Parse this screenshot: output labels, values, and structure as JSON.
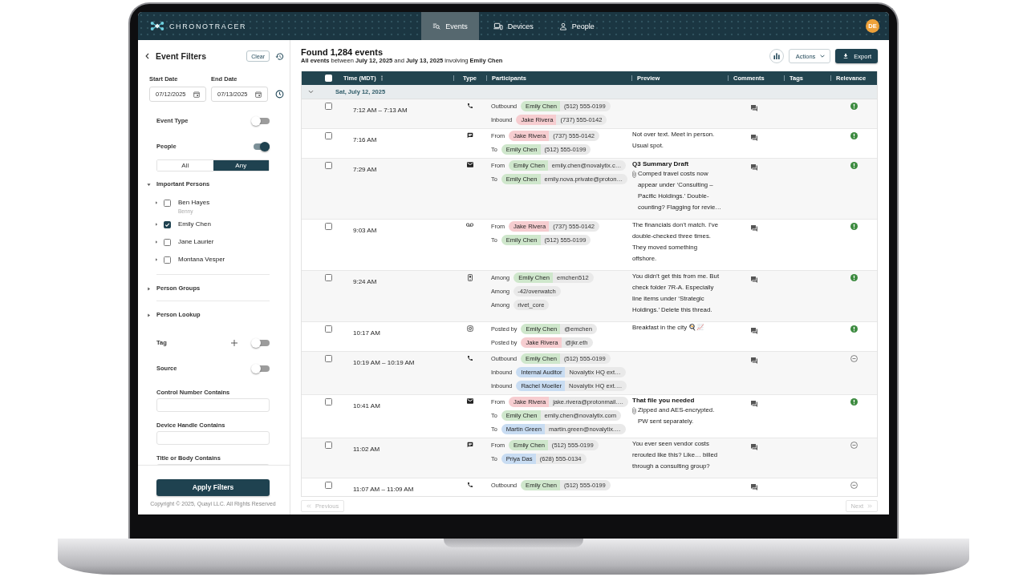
{
  "app": {
    "brand": "CHRONOTRACER",
    "nav": [
      {
        "label": "Events",
        "selected": true
      },
      {
        "label": "Devices",
        "selected": false
      },
      {
        "label": "People",
        "selected": false
      }
    ],
    "avatar": "DE"
  },
  "filters": {
    "title": "Event Filters",
    "clear_button": "Clear",
    "dates": [
      {
        "label": "Start Date",
        "value": "07/12/2025"
      },
      {
        "label": "End Date",
        "value": "07/13/2025"
      }
    ],
    "sections": [
      {
        "kind": "toggle",
        "label": "Event Type",
        "on": false
      },
      {
        "kind": "toggle",
        "label": "People",
        "on": true,
        "modes": [
          {
            "label": "All",
            "selected": false
          },
          {
            "label": "Any",
            "selected": true
          }
        ]
      },
      {
        "kind": "tree",
        "label": "Important Persons",
        "expanded": true,
        "children": [
          {
            "label": "Ben Hayes",
            "alias": "Benny",
            "checked": false,
            "expanded": false
          },
          {
            "label": "Emily Chen",
            "checked": true,
            "expanded": false
          },
          {
            "label": "Jane Laurier",
            "checked": false,
            "expanded": false
          },
          {
            "label": "Montana Vesper",
            "checked": false,
            "expanded": false
          }
        ]
      },
      {
        "kind": "tree",
        "label": "Person Groups",
        "expanded": false
      },
      {
        "kind": "tree",
        "label": "Person Lookup",
        "expanded": false
      },
      {
        "kind": "toggle",
        "label": "Tag",
        "on": false,
        "addable": true
      },
      {
        "kind": "toggle",
        "label": "Source",
        "on": false
      },
      {
        "kind": "text",
        "label": "Control Number Contains"
      },
      {
        "kind": "text",
        "label": "Device Handle Contains"
      },
      {
        "kind": "text",
        "label": "Title or Body Contains"
      }
    ],
    "apply_button": "Apply Filters",
    "copyright": "Copyright © 2025, Quayi LLC. All Rights Reserved"
  },
  "results": {
    "title": "Found 1,284 events",
    "summary": "**All events** between **July 12, 2025** and **July 13, 2025** involving **Emily Chen**",
    "actions_button": "Actions",
    "export_button": "Export"
  },
  "table": {
    "select_all_checked": false,
    "columns": [
      {
        "label": "Time (MDT)",
        "menu": true
      },
      {
        "label": "Type"
      },
      {
        "label": "Participants"
      },
      {
        "label": "Preview"
      },
      {
        "label": "Comments"
      },
      {
        "label": "Tags"
      },
      {
        "label": "Relevance"
      }
    ],
    "groups": [
      {
        "label": "Sat, July 12, 2025",
        "expanded": true,
        "rows": [
          {
            "time": "7:12 AM – 7:13 AM",
            "kind": "call",
            "checked": false,
            "participants": [
              {
                "role": "Outbound",
                "name": "Emily Chen",
                "color": "#cfe7cc",
                "handle": "(512) 555-0199"
              },
              {
                "role": "Inbound",
                "name": "Jake Rivera",
                "color": "#f6cdd0",
                "handle": "(737) 555-0142"
              }
            ],
            "relevant": true
          },
          {
            "time": "7:16 AM",
            "kind": "text",
            "checked": false,
            "participants": [
              {
                "role": "From",
                "name": "Jake Rivera",
                "color": "#f6cdd0",
                "handle": "(737) 555-0142"
              },
              {
                "role": "To",
                "name": "Emily Chen",
                "color": "#cfe7cc",
                "handle": "(512) 555-0199"
              }
            ],
            "preview": {
              "text": "Not over text. Meet in person. Usual spot."
            },
            "relevant": true
          },
          {
            "time": "7:29 AM",
            "kind": "email",
            "checked": false,
            "participants": [
              {
                "role": "From",
                "name": "Emily Chen",
                "color": "#cfe7cc",
                "handle": "emily.chen@novalytix.c…"
              },
              {
                "role": "To",
                "name": "Emily Chen",
                "color": "#cfe7cc",
                "handle": "emily.nova.private@proton…"
              }
            ],
            "preview": {
              "title": "Q3 Summary Draft",
              "attachment": true,
              "text": "Comped travel costs now appear under ‘Consulting – Pacific Holdings.’ Double-counting? Flagging for revie…"
            },
            "relevant": true
          },
          {
            "time": "9:03 AM",
            "kind": "voicemail",
            "checked": false,
            "participants": [
              {
                "role": "From",
                "name": "Jake Rivera",
                "color": "#f6cdd0",
                "handle": "(737) 555-0142"
              },
              {
                "role": "To",
                "name": "Emily Chen",
                "color": "#cfe7cc",
                "handle": "(512) 555-0199"
              }
            ],
            "preview": {
              "text": "The financials don’t match. I’ve double-checked three times. They moved something offshore."
            },
            "relevant": true
          },
          {
            "time": "9:24 AM",
            "kind": "chat",
            "checked": false,
            "participants": [
              {
                "role": "Among",
                "name": "Emily Chen",
                "color": "#cfe7cc",
                "handle": "emchen512"
              },
              {
                "role": "Among",
                "handle": "-42/overwatch"
              },
              {
                "role": "Among",
                "handle": "rivet_core"
              }
            ],
            "preview": {
              "text": "You didn’t get this from me. But check folder 7R-A. Especially line items under ‘Strategic Holdings.’ Delete this thread."
            },
            "relevant": true
          },
          {
            "time": "10:17 AM",
            "kind": "post",
            "checked": false,
            "participants": [
              {
                "role": "Posted by",
                "name": "Emily Chen",
                "color": "#cfe7cc",
                "handle": "@emchen"
              },
              {
                "role": "Posted by",
                "name": "Jake Rivera",
                "color": "#f6cdd0",
                "handle": "@jkr.eth"
              }
            ],
            "preview": {
              "text": "Breakfast in the city 🍳📈"
            },
            "relevant": true
          },
          {
            "time": "10:19 AM – 10:19 AM",
            "kind": "call",
            "checked": false,
            "participants": [
              {
                "role": "Outbound",
                "name": "Emily Chen",
                "color": "#cfe7cc",
                "handle": "(512) 555-0199"
              },
              {
                "role": "Inbound",
                "name": "Internal Auditor",
                "color": "#c8dcf2",
                "handle": "Novalytix HQ ext…"
              },
              {
                "role": "Inbound",
                "name": "Rachel Moeller",
                "color": "#c8dcf2",
                "handle": "Novalytix HQ ext.…"
              }
            ],
            "relevant": false
          },
          {
            "time": "10:41 AM",
            "kind": "email",
            "checked": false,
            "participants": [
              {
                "role": "From",
                "name": "Jake Rivera",
                "color": "#f6cdd0",
                "handle": "jake.rivera@protonmail.…"
              },
              {
                "role": "To",
                "name": "Emily Chen",
                "color": "#cfe7cc",
                "handle": "emily.chen@novalytix.com"
              },
              {
                "role": "To",
                "name": "Martin Green",
                "color": "#c8dcf2",
                "handle": "martin.green@novalytix.…"
              }
            ],
            "preview": {
              "title": "That file you needed",
              "attachment": true,
              "text": "Zipped and AES-encrypted. PW sent separately."
            },
            "relevant": true
          },
          {
            "time": "11:02 AM",
            "kind": "text",
            "checked": false,
            "participants": [
              {
                "role": "From",
                "name": "Emily Chen",
                "color": "#cfe7cc",
                "handle": "(512) 555-0199"
              },
              {
                "role": "To",
                "name": "Priya Das",
                "color": "#c8dcf2",
                "handle": "(628) 555-0134"
              }
            ],
            "preview": {
              "text": "You ever seen vendor costs rerouted like this? Like… billed through a consulting group?"
            },
            "relevant": false
          },
          {
            "time": "11:07 AM – 11:09 AM",
            "kind": "call",
            "checked": false,
            "participants": [
              {
                "role": "Outbound",
                "name": "Emily Chen",
                "color": "#cfe7cc",
                "handle": "(512) 555-0199"
              }
            ],
            "relevant": false
          }
        ]
      }
    ]
  },
  "pagination": {
    "previous": {
      "label": "Previous",
      "disabled": true
    },
    "next": {
      "label": "Next",
      "disabled": true
    }
  }
}
